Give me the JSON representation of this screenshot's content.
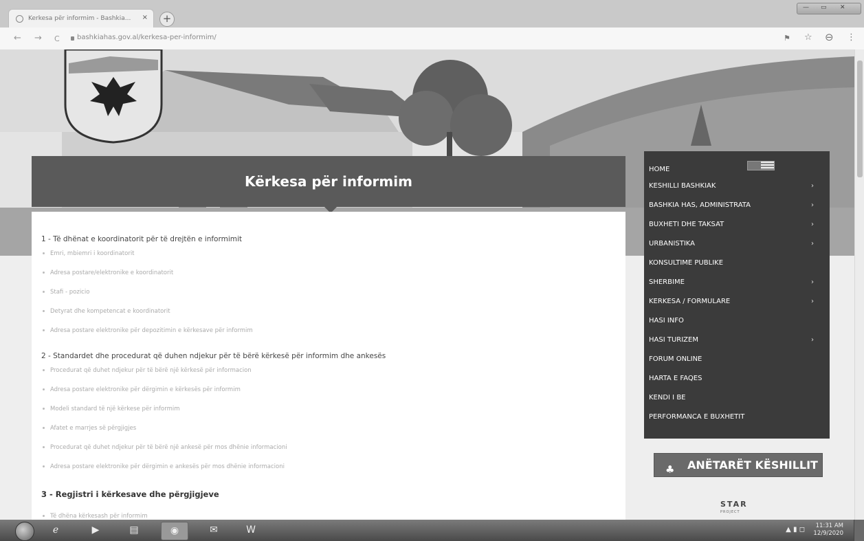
{
  "browser": {
    "tab_title": "Kerkesa për informim - Bashkia...",
    "tab_close": "×",
    "new_tab": "+",
    "url": "bashkiahas.gov.al/kerkesa-per-informim/",
    "back": "←",
    "forward": "→",
    "reload": "C"
  },
  "page": {
    "banner_title": "Kërkesa për informim",
    "sections": [
      {
        "heading": "1 - Të dhënat e koordinatorit për të drejtën e informimit",
        "items": [
          "Emri, mbiemri i koordinatorit",
          "Adresa postare/elektronike e koordinatorit",
          "Stafi - pozicio",
          "Detyrat dhe kompetencat e koordinatorit",
          "Adresa postare elektronike për depozitimin e kërkesave për informim"
        ]
      },
      {
        "heading": "2 - Standardet dhe procedurat që duhen ndjekur për të bërë kërkesë për informim dhe ankesës",
        "items": [
          "Procedurat që duhet ndjekur për të bërë një kërkesë për informacion",
          "Adresa postare elektronike për dërgimin e kërkesës për informim",
          "Modeli standard të një kërkese për informim",
          "Afatet e marrjes së përgjigjes",
          "Procedurat që duhet ndjekur për të bërë një ankesë për mos dhënie informacioni",
          "Adresa postare elektronike për dërgimin e ankesës për mos dhënie informacioni"
        ]
      },
      {
        "heading": "3 - Regjistri i kërkesave dhe përgjigjeve",
        "items": [
          "Të dhëna kërkesash për informim"
        ]
      }
    ]
  },
  "menu": {
    "items": [
      {
        "label": "HOME",
        "chevron": ""
      },
      {
        "label": "KESHILLI BASHKIAK",
        "chevron": "›"
      },
      {
        "label": "BASHKIA HAS, ADMINISTRATA",
        "chevron": "›"
      },
      {
        "label": "BUXHETI DHE TAKSAT",
        "chevron": "›"
      },
      {
        "label": "URBANISTIKA",
        "chevron": "›"
      },
      {
        "label": "KONSULTIME PUBLIKE",
        "chevron": ""
      },
      {
        "label": "SHERBIME",
        "chevron": "›"
      },
      {
        "label": "KERKESA / FORMULARE",
        "chevron": "›"
      },
      {
        "label": "HASI INFO",
        "chevron": ""
      },
      {
        "label": "HASI TURIZEM",
        "chevron": "›"
      },
      {
        "label": "FORUM ONLINE",
        "chevron": ""
      },
      {
        "label": "HARTA E FAQES",
        "chevron": ""
      },
      {
        "label": "KENDI I BE",
        "chevron": ""
      },
      {
        "label": "PERFORMANCA E BUXHETIT",
        "chevron": ""
      }
    ]
  },
  "sidebar": {
    "anetaret_label": "ANËTARËT KËSHILLIT",
    "anetaret_icon": "♣",
    "star_label": "STAR",
    "star_sub": "PROJECT"
  },
  "taskbar": {
    "time": "11:31 AM",
    "date": "12/9/2020",
    "tray": "▲ ▮ ◻"
  },
  "colors": {
    "banner": "#5a5a5a",
    "menu_bg": "#3b3b3b",
    "content_bg": "#ffffff"
  }
}
